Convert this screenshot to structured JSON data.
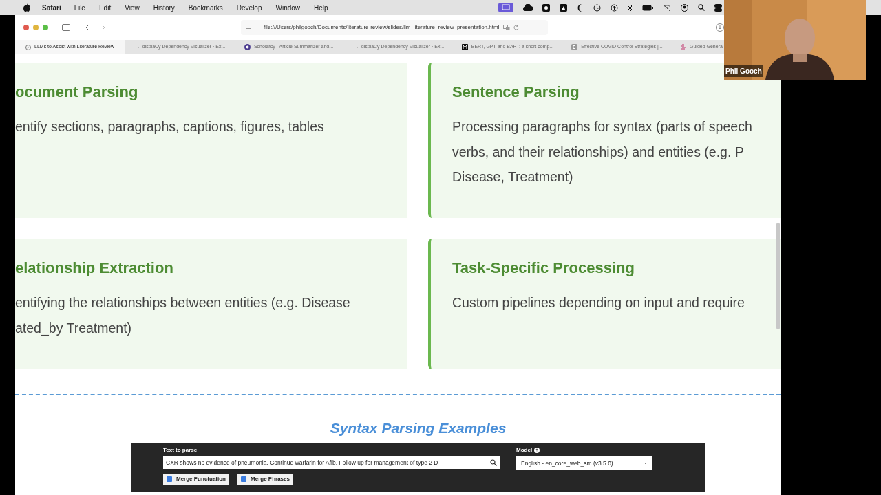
{
  "menu_bar": {
    "app": "Safari",
    "items": [
      "File",
      "Edit",
      "View",
      "History",
      "Bookmarks",
      "Develop",
      "Window",
      "Help"
    ]
  },
  "browser": {
    "url": "file:///Users/philgooch/Documents/literature-review/slides/llm_literature_review_presentation.html"
  },
  "tabs": [
    {
      "label": "LLMs to Assist with Literature Review",
      "selected": true,
      "kind": "compass"
    },
    {
      "label": "displaCy Dependency Visualizer · Ex...",
      "selected": false,
      "kind": "loading"
    },
    {
      "label": "Scholarcy - Article Summarizer and...",
      "selected": false,
      "kind": "circle"
    },
    {
      "label": "displaCy Dependency Visualizer · Ex...",
      "selected": false,
      "kind": "loading"
    },
    {
      "label": "BERT, GPT and BART: a short comp...",
      "selected": false,
      "kind": "dark-square"
    },
    {
      "label": "Effective COVID Control Strategies |...",
      "selected": false,
      "kind": "grey-square"
    },
    {
      "label": "Guided Genera",
      "selected": false,
      "kind": "bars"
    }
  ],
  "cards": [
    {
      "title": "ocument Parsing",
      "lines": [
        "entify sections, paragraphs, captions, figures, tables"
      ],
      "accent": false
    },
    {
      "title": "Sentence Parsing",
      "lines": [
        "Processing paragraphs for syntax (parts of speech",
        "verbs, and their relationships) and entities (e.g. P",
        "Disease, Treatment)"
      ],
      "accent": true
    },
    {
      "title": "elationship Extraction",
      "lines": [
        "entifying the relationships between entities (e.g. Disease",
        "ated_by Treatment)"
      ],
      "accent": false
    },
    {
      "title": "Task-Specific Processing",
      "lines": [
        "Custom pipelines depending on input and require"
      ],
      "accent": true
    }
  ],
  "section_title": "Syntax Parsing Examples",
  "parser": {
    "text_label": "Text to parse",
    "text_value": "CXR shows no evidence of pneumonia. Continue warfarin for Afib. Follow up for management of type 2 D",
    "model_label": "Model",
    "model_value": "English - en_core_web_sm (v3.5.0)",
    "options": [
      {
        "label": "Merge Punctuation",
        "checked": true
      },
      {
        "label": "Merge Phrases",
        "checked": true
      }
    ]
  },
  "webcam": {
    "name": "Phil Gooch"
  }
}
